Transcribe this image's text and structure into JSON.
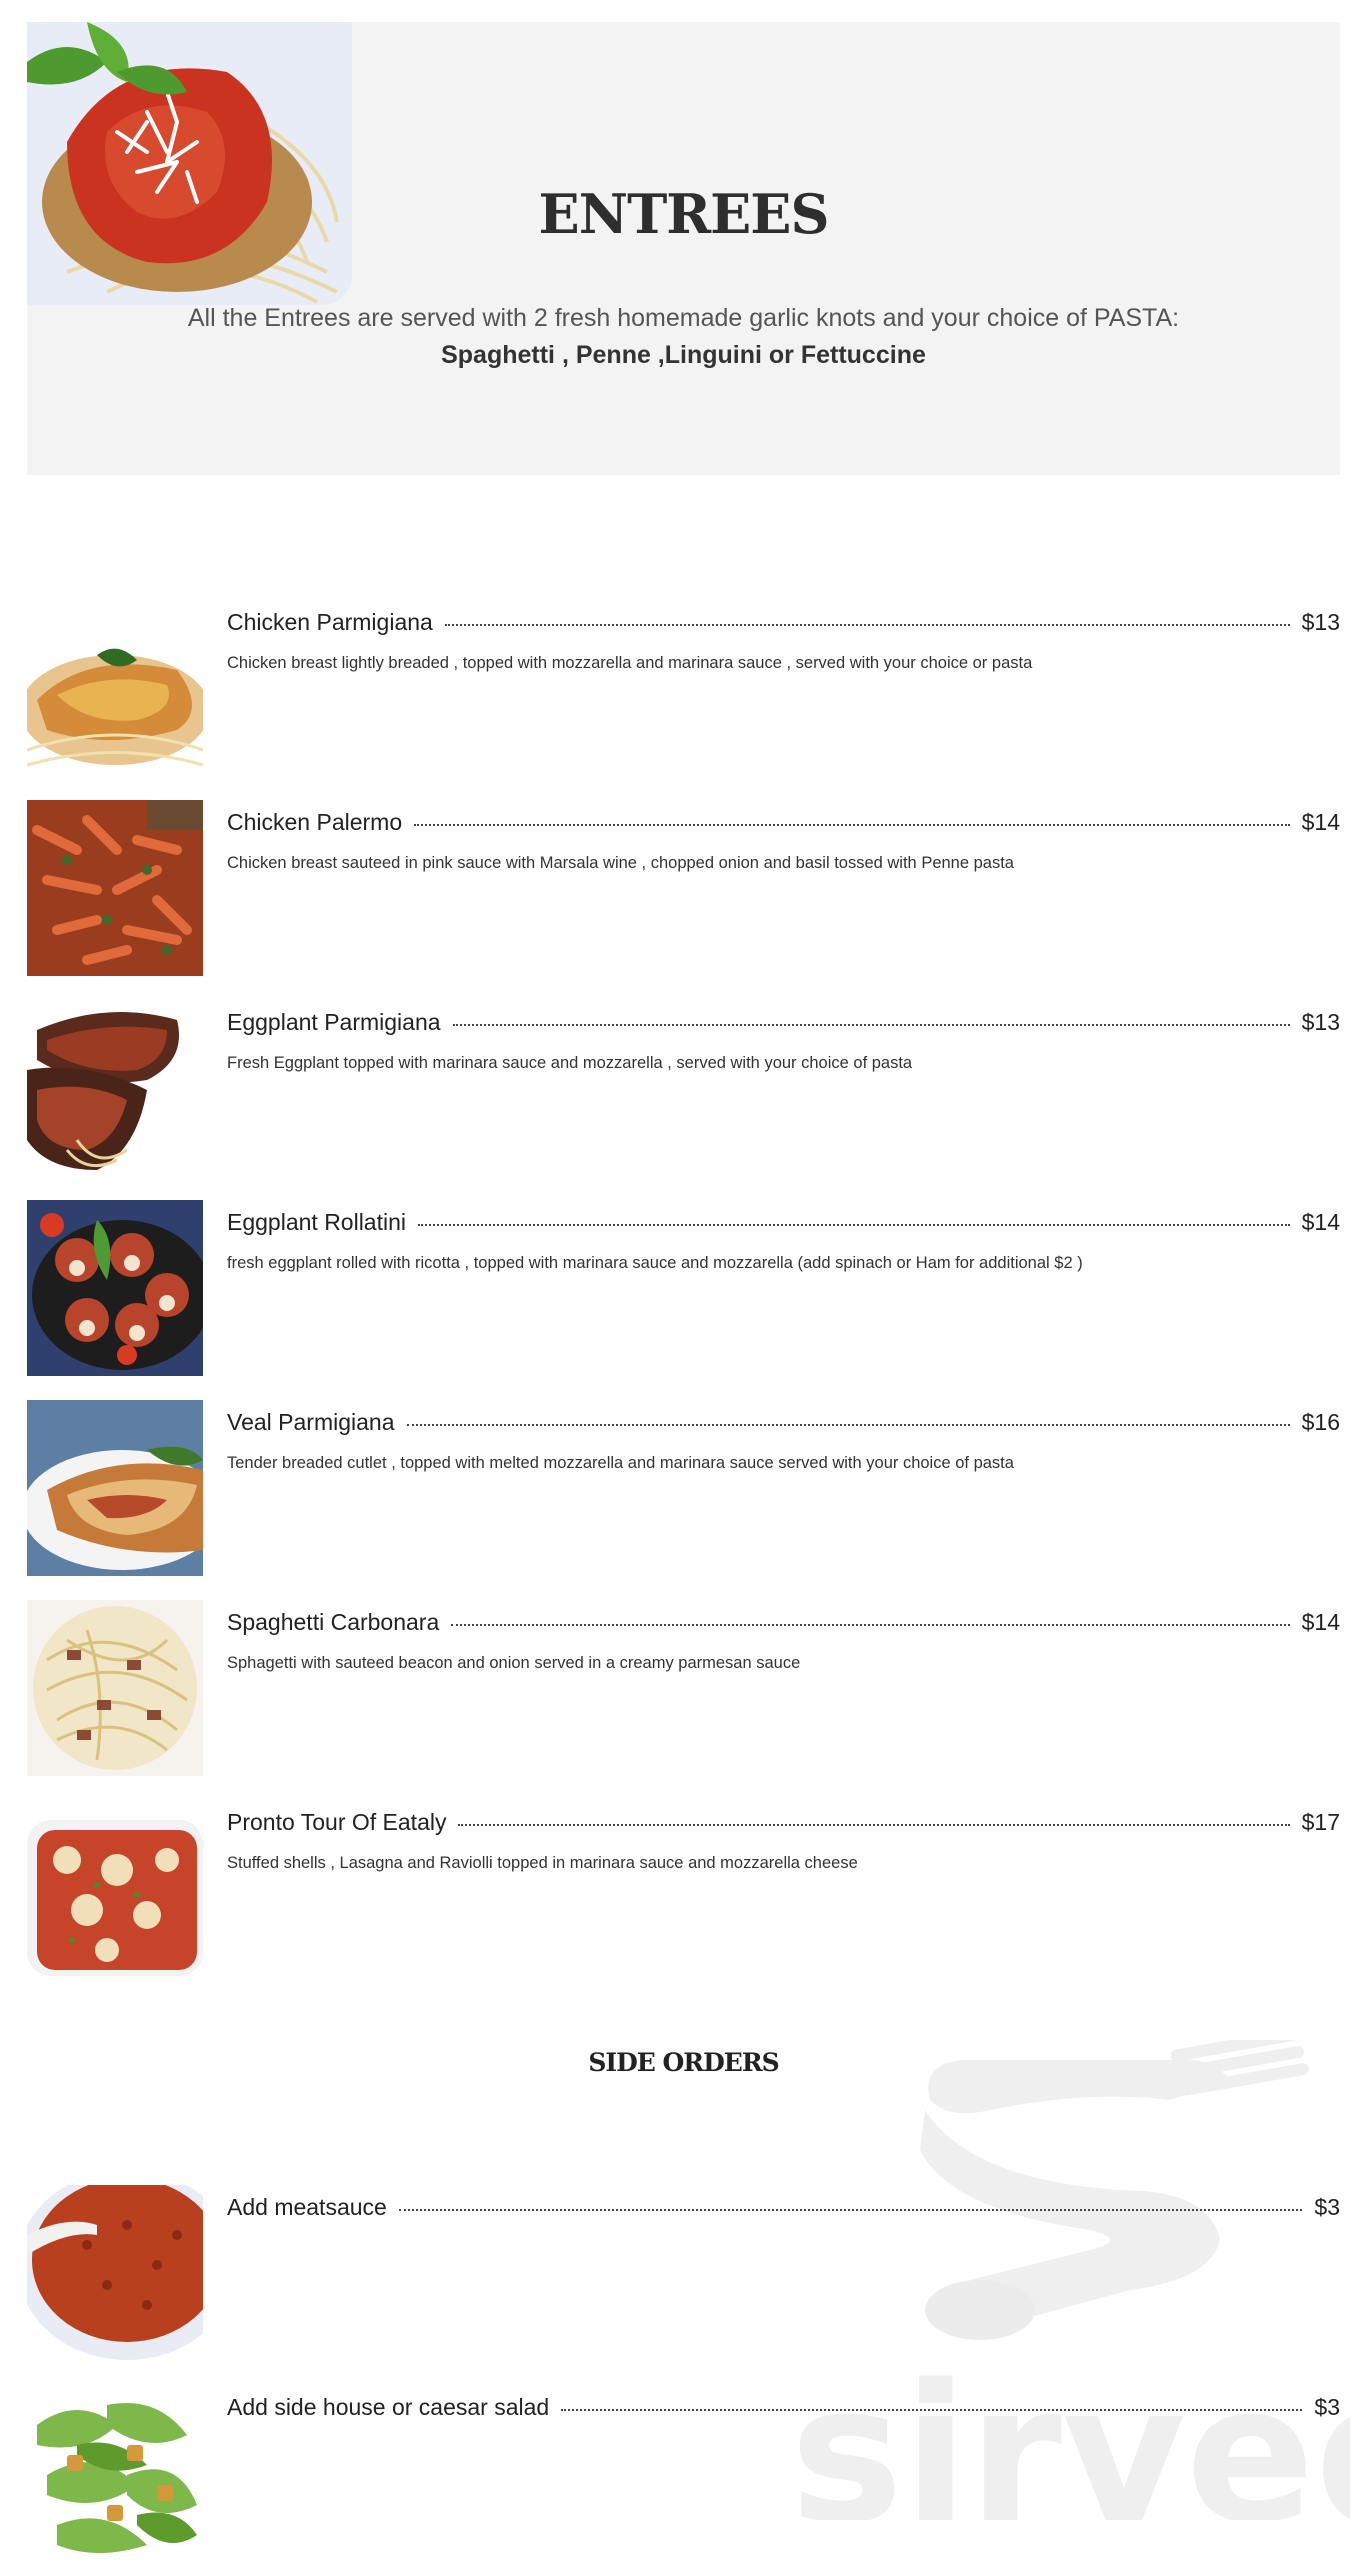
{
  "header": {
    "title": "ENTREES",
    "subtitle_line1": "All the Entrees are served with 2 fresh homemade garlic knots and your choice of PASTA:",
    "subtitle_line2": "Spaghetti , Penne ,Linguini or Fettuccine"
  },
  "entrees": [
    {
      "name": "Chicken Parmigiana",
      "price": "$13",
      "description": "Chicken breast lightly breaded , topped with mozzarella and marinara sauce , served with your choice or pasta"
    },
    {
      "name": "Chicken Palermo",
      "price": "$14",
      "description": "Chicken breast sauteed in pink sauce with Marsala wine , chopped onion and basil tossed with Penne pasta"
    },
    {
      "name": "Eggplant Parmigiana",
      "price": "$13",
      "description": "Fresh Eggplant topped with marinara sauce and mozzarella , served with your choice of pasta"
    },
    {
      "name": "Eggplant Rollatini",
      "price": "$14",
      "description": "fresh eggplant rolled with ricotta , topped with marinara sauce and mozzarella (add spinach or Ham for additional $2 )"
    },
    {
      "name": "Veal Parmigiana",
      "price": "$16",
      "description": "Tender breaded cutlet , topped with melted mozzarella and marinara sauce served with your choice of pasta"
    },
    {
      "name": "Spaghetti Carbonara",
      "price": "$14",
      "description": "Sphagetti with sauteed beacon and onion served in a creamy parmesan sauce"
    },
    {
      "name": "Pronto Tour Of Eataly",
      "price": "$17",
      "description": "Stuffed shells , Lasagna and Raviolli topped in marinara sauce and mozzarella cheese"
    }
  ],
  "side_orders": {
    "title": "SIDE ORDERS",
    "items": [
      {
        "name": "Add meatsauce",
        "price": "$3"
      },
      {
        "name": "Add side house or caesar salad",
        "price": "$3"
      }
    ]
  },
  "watermark": {
    "text": "sirved",
    "icon": "fork-spoon-icon"
  }
}
